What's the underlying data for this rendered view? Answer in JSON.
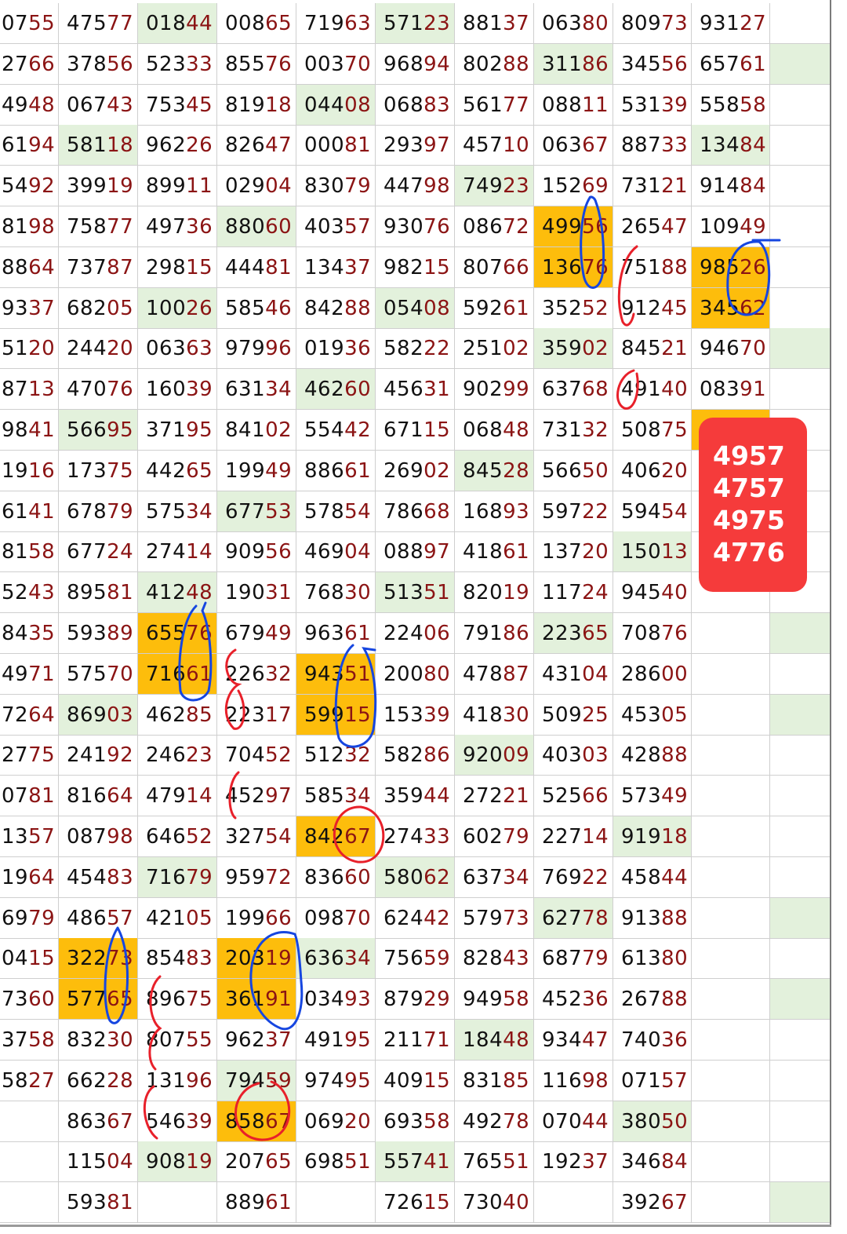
{
  "rows": [
    [
      "0755",
      "47577",
      "01844",
      "00865",
      "71963",
      "57123",
      "88137",
      "06380",
      "80973",
      "93127",
      ""
    ],
    [
      "2766",
      "37856",
      "52333",
      "85576",
      "00370",
      "96894",
      "80288",
      "31186",
      "34556",
      "65761",
      ""
    ],
    [
      "4948",
      "06743",
      "75345",
      "81918",
      "04408",
      "06883",
      "56177",
      "08811",
      "53139",
      "55858",
      ""
    ],
    [
      "6194",
      "58118",
      "96226",
      "82647",
      "00081",
      "29397",
      "45710",
      "06367",
      "88733",
      "13484",
      ""
    ],
    [
      "5492",
      "39919",
      "89911",
      "02904",
      "83079",
      "44798",
      "74923",
      "15269",
      "73121",
      "91484",
      ""
    ],
    [
      "8198",
      "75877",
      "49736",
      "88060",
      "40357",
      "93076",
      "08672",
      "49956",
      "26547",
      "10949",
      ""
    ],
    [
      "8864",
      "73787",
      "29815",
      "44481",
      "13437",
      "98215",
      "80766",
      "13676",
      "75188",
      "98526",
      ""
    ],
    [
      "9337",
      "68205",
      "10026",
      "58546",
      "84288",
      "05408",
      "59261",
      "35252",
      "91245",
      "34562",
      ""
    ],
    [
      "5120",
      "24420",
      "06363",
      "97996",
      "01936",
      "58222",
      "25102",
      "35902",
      "84521",
      "94670",
      ""
    ],
    [
      "8713",
      "47076",
      "16039",
      "63134",
      "46260",
      "45631",
      "90299",
      "63768",
      "49140",
      "08391",
      ""
    ],
    [
      "9841",
      "56695",
      "37195",
      "84102",
      "55442",
      "67115",
      "06848",
      "73132",
      "50875",
      "",
      ""
    ],
    [
      "1916",
      "17375",
      "44265",
      "19949",
      "88661",
      "26902",
      "84528",
      "56650",
      "40620",
      "",
      ""
    ],
    [
      "6141",
      "67879",
      "57534",
      "67753",
      "57854",
      "78668",
      "16893",
      "59722",
      "59454",
      "",
      ""
    ],
    [
      "8158",
      "67724",
      "27414",
      "90956",
      "46904",
      "08897",
      "41861",
      "13720",
      "15013",
      "",
      ""
    ],
    [
      "5243",
      "89581",
      "41248",
      "19031",
      "76830",
      "51351",
      "82019",
      "11724",
      "94540",
      "",
      ""
    ],
    [
      "8435",
      "59389",
      "65576",
      "67949",
      "96361",
      "22406",
      "79186",
      "22365",
      "70876",
      "",
      ""
    ],
    [
      "4971",
      "57570",
      "71661",
      "22632",
      "94351",
      "20080",
      "47887",
      "43104",
      "28600",
      "",
      ""
    ],
    [
      "7264",
      "86903",
      "46285",
      "22317",
      "59915",
      "15339",
      "41830",
      "50925",
      "45305",
      "",
      ""
    ],
    [
      "2775",
      "24192",
      "24623",
      "70452",
      "51232",
      "58286",
      "92009",
      "40303",
      "42888",
      "",
      ""
    ],
    [
      "0781",
      "81664",
      "47914",
      "45297",
      "58534",
      "35944",
      "27221",
      "52566",
      "57349",
      "",
      ""
    ],
    [
      "1357",
      "08798",
      "64652",
      "32754",
      "84267",
      "27433",
      "60279",
      "22714",
      "91918",
      "",
      ""
    ],
    [
      "1964",
      "45483",
      "71679",
      "95972",
      "83660",
      "58062",
      "63734",
      "76922",
      "45844",
      "",
      ""
    ],
    [
      "6979",
      "48657",
      "42105",
      "19966",
      "09870",
      "62442",
      "57973",
      "62778",
      "91388",
      "",
      ""
    ],
    [
      "0415",
      "32273",
      "85483",
      "20319",
      "63634",
      "75659",
      "82843",
      "68779",
      "61380",
      "",
      ""
    ],
    [
      "7360",
      "57765",
      "89675",
      "36191",
      "03493",
      "87929",
      "94958",
      "45236",
      "26788",
      "",
      ""
    ],
    [
      "3758",
      "83230",
      "80755",
      "96237",
      "49195",
      "21171",
      "18448",
      "93447",
      "74036",
      "",
      ""
    ],
    [
      "5827",
      "66228",
      "13196",
      "79459",
      "97495",
      "40915",
      "83185",
      "11698",
      "07157",
      "",
      ""
    ],
    [
      "",
      "86367",
      "54639",
      "85867",
      "06920",
      "69358",
      "49278",
      "07044",
      "38050",
      "",
      ""
    ],
    [
      "",
      "11504",
      "90819",
      "20765",
      "69851",
      "55741",
      "76551",
      "19237",
      "34684",
      "",
      ""
    ],
    [
      "",
      "59381",
      "",
      "88961",
      "",
      "72615",
      "73040",
      "",
      "39267",
      "",
      ""
    ]
  ],
  "green_cells": [
    [
      0,
      2
    ],
    [
      0,
      5
    ],
    [
      1,
      7
    ],
    [
      1,
      10
    ],
    [
      2,
      4
    ],
    [
      3,
      1
    ],
    [
      3,
      9
    ],
    [
      4,
      6
    ],
    [
      5,
      3
    ],
    [
      7,
      2
    ],
    [
      7,
      5
    ],
    [
      8,
      7
    ],
    [
      8,
      10
    ],
    [
      9,
      4
    ],
    [
      10,
      1
    ],
    [
      11,
      6
    ],
    [
      12,
      3
    ],
    [
      13,
      8
    ],
    [
      14,
      2
    ],
    [
      14,
      5
    ],
    [
      15,
      7
    ],
    [
      15,
      10
    ],
    [
      17,
      1
    ],
    [
      17,
      10
    ],
    [
      18,
      6
    ],
    [
      20,
      8
    ],
    [
      21,
      2
    ],
    [
      21,
      5
    ],
    [
      22,
      7
    ],
    [
      22,
      10
    ],
    [
      23,
      4
    ],
    [
      24,
      10
    ],
    [
      25,
      6
    ],
    [
      26,
      3
    ],
    [
      27,
      8
    ],
    [
      28,
      2
    ],
    [
      28,
      5
    ],
    [
      29,
      10
    ]
  ],
  "orange_cells": [
    [
      5,
      7
    ],
    [
      6,
      7
    ],
    [
      6,
      9
    ],
    [
      7,
      9
    ],
    [
      10,
      9
    ],
    [
      15,
      2
    ],
    [
      16,
      2
    ],
    [
      16,
      4
    ],
    [
      17,
      4
    ],
    [
      20,
      4
    ],
    [
      23,
      1
    ],
    [
      24,
      1
    ],
    [
      23,
      3
    ],
    [
      24,
      3
    ],
    [
      27,
      3
    ]
  ],
  "colors": {
    "green": "#e3f1dc",
    "orange": "#fdbd0c",
    "digit_highlight": "#8b1414",
    "callout": "#f53b3b",
    "blue_ink": "#1646e0",
    "red_ink": "#e8202a"
  },
  "callout": {
    "lines": [
      "4957",
      "4757",
      "4975",
      "4776"
    ]
  }
}
